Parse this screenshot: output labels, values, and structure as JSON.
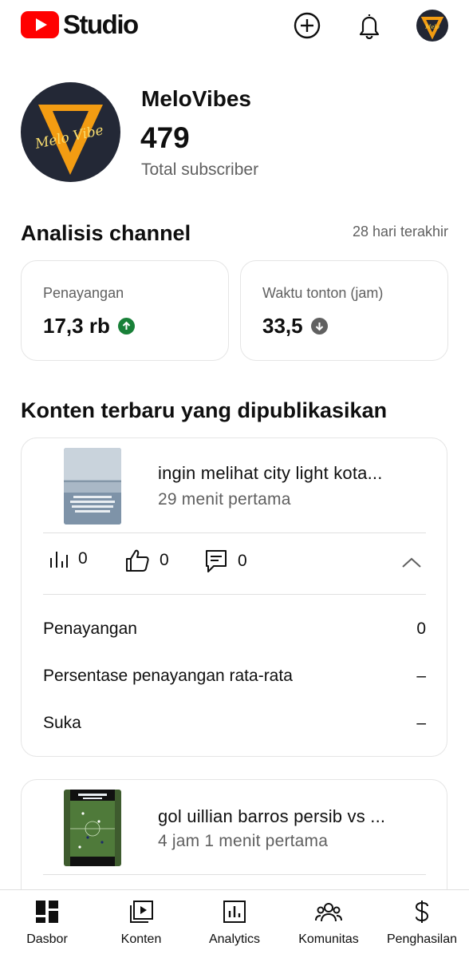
{
  "header": {
    "logo_text": "Studio",
    "create_icon": "add-circle-icon",
    "notifications_icon": "bell-icon",
    "brand_color": "#ff0000"
  },
  "channel": {
    "name": "MeloVibes",
    "avatar_text": "Melo Vibe",
    "subscriber_count": "479",
    "subscriber_label": "Total subscriber"
  },
  "analytics": {
    "title": "Analisis channel",
    "period": "28 hari terakhir",
    "metrics": [
      {
        "label": "Penayangan",
        "value": "17,3 rb",
        "trend": "up",
        "trend_color": "#188038"
      },
      {
        "label": "Waktu tonton (jam)",
        "value": "33,5",
        "trend": "down",
        "trend_color": "#606060"
      }
    ]
  },
  "recent": {
    "title": "Konten terbaru yang dipublikasikan",
    "videos": [
      {
        "title": "ingin melihat city light kota...",
        "subtitle": "29 menit pertama",
        "views": "0",
        "likes": "0",
        "comments": "0",
        "expanded": true,
        "details": [
          {
            "label": "Penayangan",
            "value": "0"
          },
          {
            "label": "Persentase penayangan rata-rata",
            "value": "–"
          },
          {
            "label": "Suka",
            "value": "–"
          }
        ]
      },
      {
        "title": "gol uillian barros persib vs ...",
        "subtitle": "4 jam 1 menit pertama"
      }
    ]
  },
  "nav": {
    "items": [
      {
        "label": "Dasbor",
        "icon": "dashboard-icon",
        "active": true
      },
      {
        "label": "Konten",
        "icon": "video-library-icon"
      },
      {
        "label": "Analytics",
        "icon": "analytics-icon"
      },
      {
        "label": "Komunitas",
        "icon": "community-icon"
      },
      {
        "label": "Penghasilan",
        "icon": "dollar-icon"
      }
    ]
  }
}
